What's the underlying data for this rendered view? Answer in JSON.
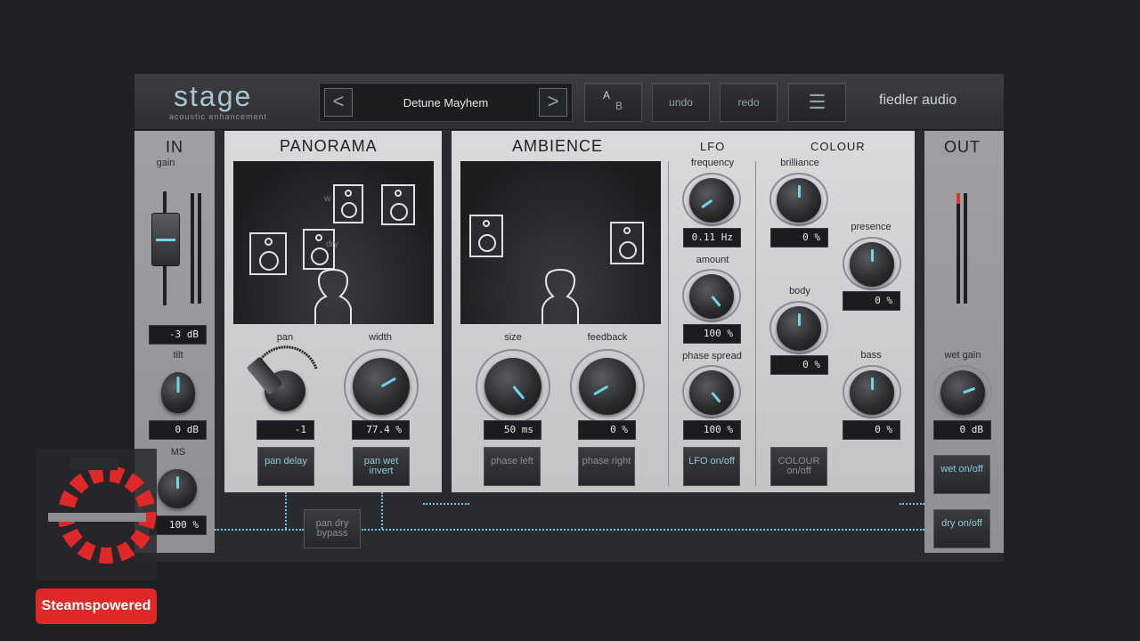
{
  "header": {
    "logo": "stage",
    "subtitle": "acoustic enhancement",
    "vendor": "fiedler audio",
    "preset_name": "Detune Mayhem",
    "prev_glyph": "<",
    "next_glyph": ">",
    "ab_a": "A",
    "ab_b": "B",
    "undo_label": "undo",
    "redo_label": "redo",
    "menu_glyph": "☰"
  },
  "in_section": {
    "title": "IN",
    "gain_label": "gain",
    "gain_value": "-3 dB",
    "tilt_label": "tilt",
    "tilt_value": "0 dB",
    "ms_label": "MS",
    "ms_value": "100 %"
  },
  "panorama": {
    "title": "PANORAMA",
    "pan_label": "pan",
    "pan_value": "-1",
    "width_label": "width",
    "width_value": "77.4 %",
    "pan_delay_label": "pan delay",
    "pan_wet_invert_label": "pan wet invert",
    "pan_dry_bypass_label": "pan dry bypass",
    "spk_label_w": "w",
    "spk_label_dry": "dry"
  },
  "ambience": {
    "title": "AMBIENCE",
    "size_label": "size",
    "size_value": "50 ms",
    "feedback_label": "feedback",
    "feedback_value": "0 %",
    "phase_left_label": "phase left",
    "phase_right_label": "phase right"
  },
  "lfo": {
    "title": "LFO",
    "frequency_label": "frequency",
    "frequency_value": "0.11 Hz",
    "amount_label": "amount",
    "amount_value": "100 %",
    "phase_spread_label": "phase spread",
    "phase_spread_value": "100 %",
    "lfo_toggle_label": "LFO on/off"
  },
  "colour": {
    "title": "COLOUR",
    "brilliance_label": "brilliance",
    "brilliance_value": "0 %",
    "presence_label": "presence",
    "presence_value": "0 %",
    "body_label": "body",
    "body_value": "0 %",
    "bass_label": "bass",
    "bass_value": "0 %",
    "colour_toggle_label": "COLOUR on/off"
  },
  "out_section": {
    "title": "OUT",
    "wet_gain_label": "wet gain",
    "wet_gain_value": "0 dB",
    "wet_toggle_label": "wet on/off",
    "dry_toggle_label": "dry on/off"
  },
  "watermark": {
    "text": "Steamspowered"
  },
  "colors": {
    "accent": "#6fd3ec",
    "panel": "#cfd1d3",
    "background": "#1f2024"
  }
}
